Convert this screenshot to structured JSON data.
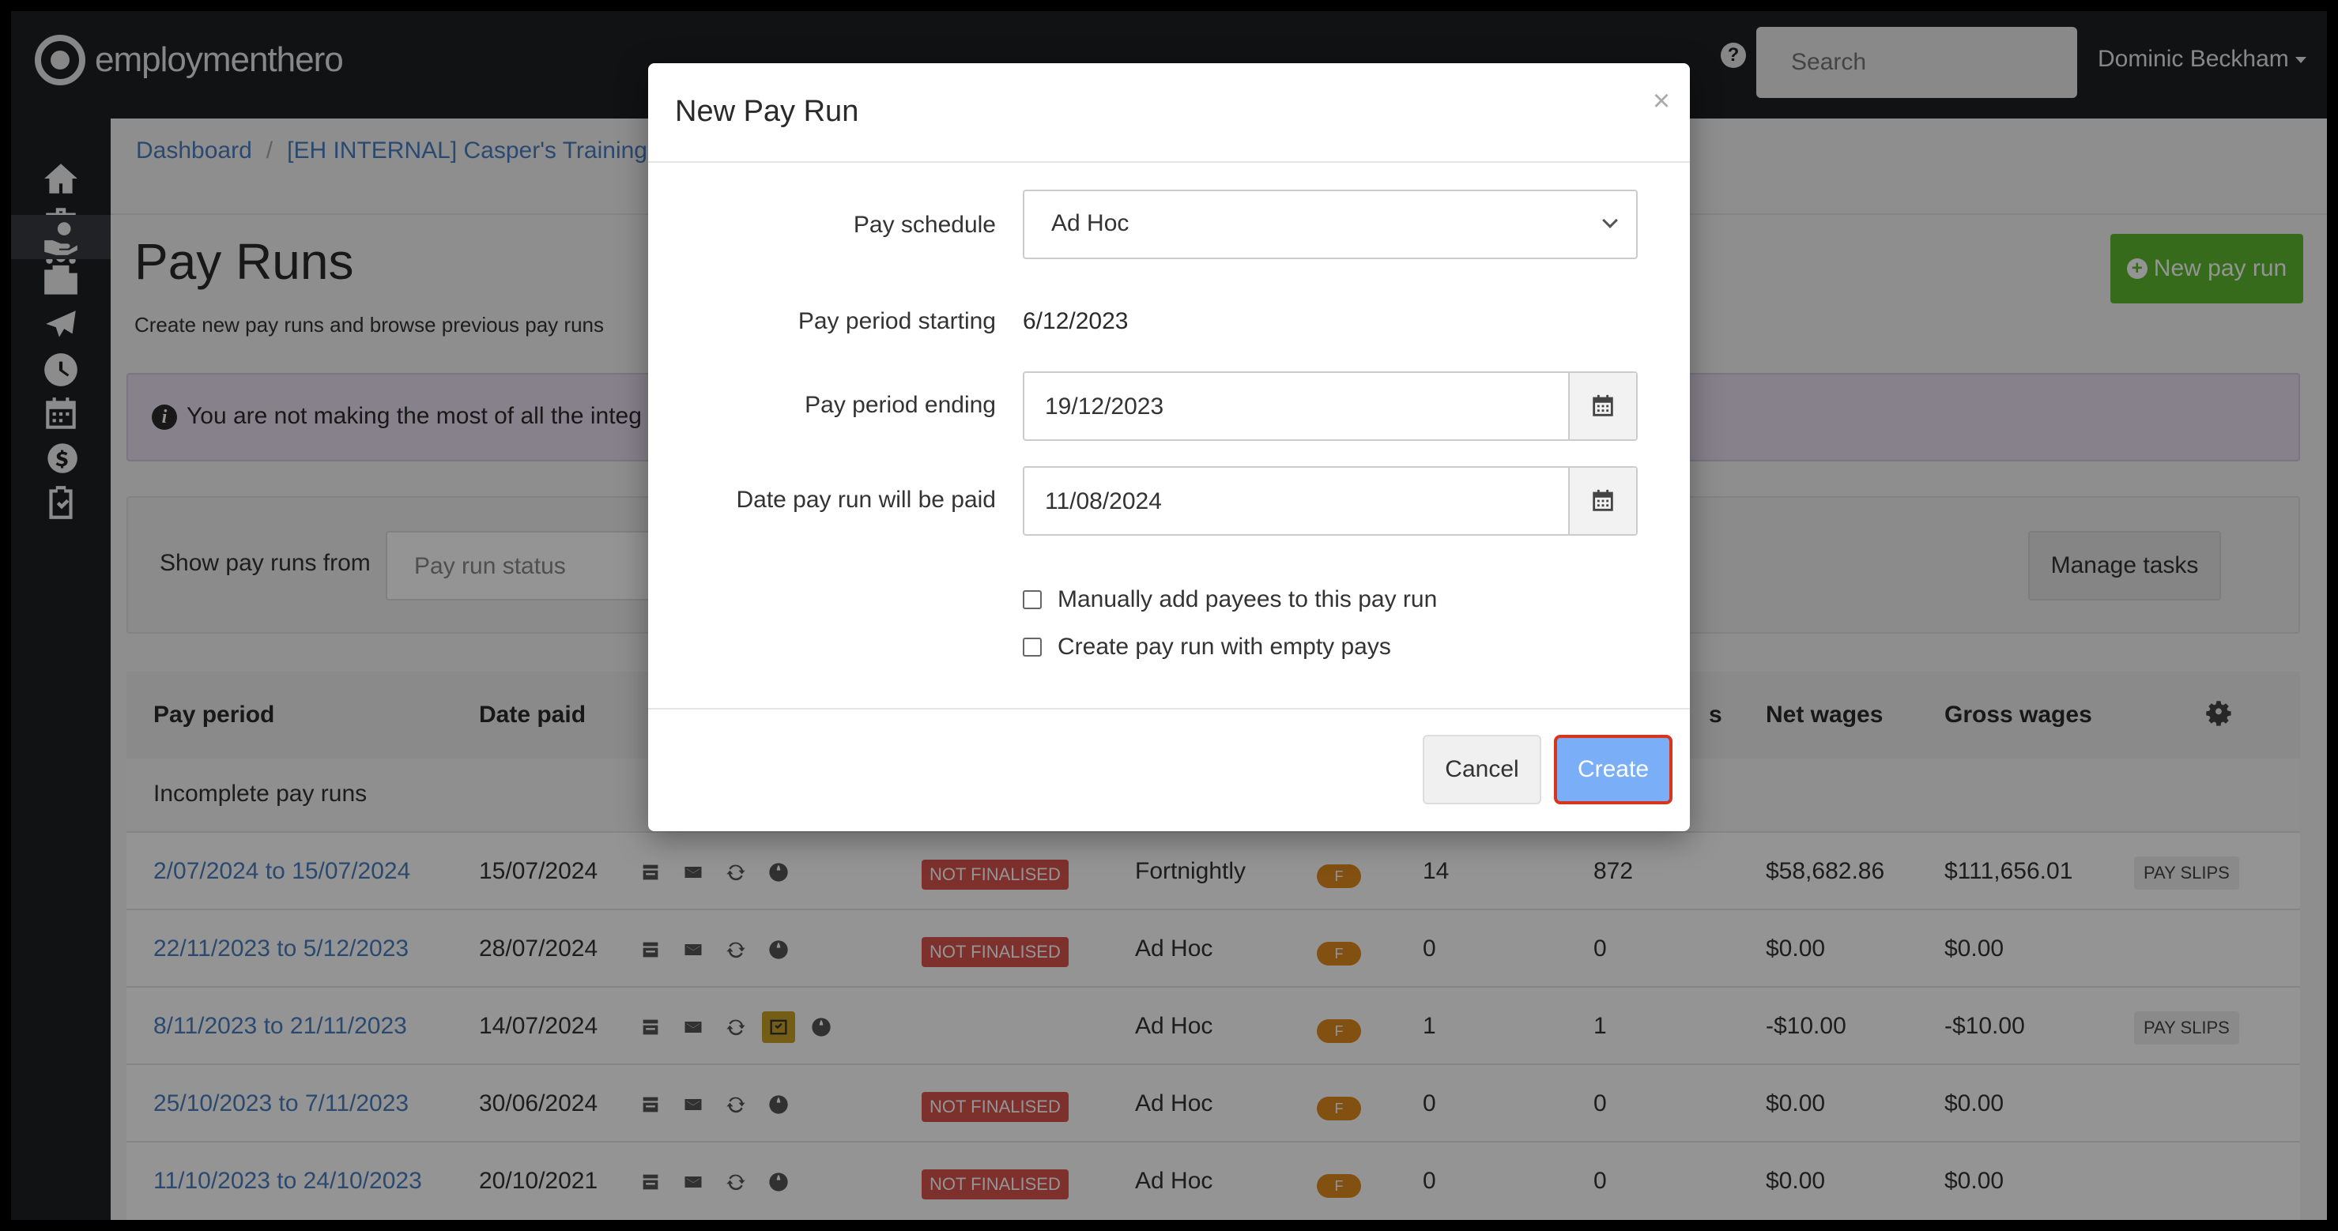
{
  "topbar": {
    "logo_text": "employmenthero",
    "search_placeholder": "Search",
    "user_name": "Dominic Beckham"
  },
  "sidebar": {
    "items": [
      {
        "name": "home-icon"
      },
      {
        "name": "briefcase-icon"
      },
      {
        "name": "people-icon"
      },
      {
        "name": "payroll-hand-icon",
        "active": true
      },
      {
        "name": "folder-icon"
      },
      {
        "name": "plane-icon"
      },
      {
        "name": "clock-icon"
      },
      {
        "name": "calendar-icon"
      },
      {
        "name": "dollar-coins-icon"
      },
      {
        "name": "clipboard-check-icon"
      }
    ]
  },
  "breadcrumb": {
    "home": "Dashboard",
    "separator": "/",
    "business": "[EH INTERNAL] Casper's Training"
  },
  "page": {
    "title": "Pay Runs",
    "subtitle": "Create new pay runs and browse previous pay runs",
    "new_pay_run_label": "New pay run",
    "alert_text": "You are not making the most of all the integ"
  },
  "filter": {
    "label": "Show pay runs from",
    "status_placeholder": "Pay run status",
    "manage_tasks_label": "Manage tasks"
  },
  "table": {
    "headers": {
      "pay_period": "Pay period",
      "date_paid": "Date paid",
      "fragment": "s",
      "net_wages": "Net wages",
      "gross_wages": "Gross wages"
    },
    "group_label": "Incomplete pay runs",
    "rows": [
      {
        "period": "2/07/2024 to 15/07/2024",
        "date_paid": "15/07/2024",
        "status": "NOT FINALISED",
        "schedule": "Fortnightly",
        "badge": "F",
        "col_a": "14",
        "col_b": "872",
        "net": "$58,682.86",
        "gross": "$111,656.01",
        "payslips": "PAY SLIPS",
        "highlight_icon": false
      },
      {
        "period": "22/11/2023 to 5/12/2023",
        "date_paid": "28/07/2024",
        "status": "NOT FINALISED",
        "schedule": "Ad Hoc",
        "badge": "F",
        "col_a": "0",
        "col_b": "0",
        "net": "$0.00",
        "gross": "$0.00",
        "payslips": "",
        "highlight_icon": false
      },
      {
        "period": "8/11/2023 to 21/11/2023",
        "date_paid": "14/07/2024",
        "status": "",
        "schedule": "Ad Hoc",
        "badge": "F",
        "col_a": "1",
        "col_b": "1",
        "net": "-$10.00",
        "gross": "-$10.00",
        "payslips": "PAY SLIPS",
        "highlight_icon": true
      },
      {
        "period": "25/10/2023 to 7/11/2023",
        "date_paid": "30/06/2024",
        "status": "NOT FINALISED",
        "schedule": "Ad Hoc",
        "badge": "F",
        "col_a": "0",
        "col_b": "0",
        "net": "$0.00",
        "gross": "$0.00",
        "payslips": "",
        "highlight_icon": false
      },
      {
        "period": "11/10/2023 to 24/10/2023",
        "date_paid": "20/10/2021",
        "status": "NOT FINALISED",
        "schedule": "Ad Hoc",
        "badge": "F",
        "col_a": "0",
        "col_b": "0",
        "net": "$0.00",
        "gross": "$0.00",
        "payslips": "",
        "highlight_icon": false
      }
    ]
  },
  "modal": {
    "title": "New Pay Run",
    "close_symbol": "×",
    "pay_schedule_label": "Pay schedule",
    "pay_schedule_value": "Ad Hoc",
    "period_start_label": "Pay period starting",
    "period_start_value": "6/12/2023",
    "period_end_label": "Pay period ending",
    "period_end_value": "19/12/2023",
    "pay_date_label": "Date pay run will be paid",
    "pay_date_value": "11/08/2024",
    "manual_payees_label": "Manually add payees to this pay run",
    "empty_pays_label": "Create pay run with empty pays",
    "cancel_label": "Cancel",
    "create_label": "Create"
  },
  "colors": {
    "accent_green": "#5cb82e",
    "link_blue": "#4a7fc0",
    "status_red": "#d9534f",
    "badge_orange": "#e08a1e",
    "create_blue": "#7aaef7",
    "highlight_outline": "#d9341c"
  }
}
